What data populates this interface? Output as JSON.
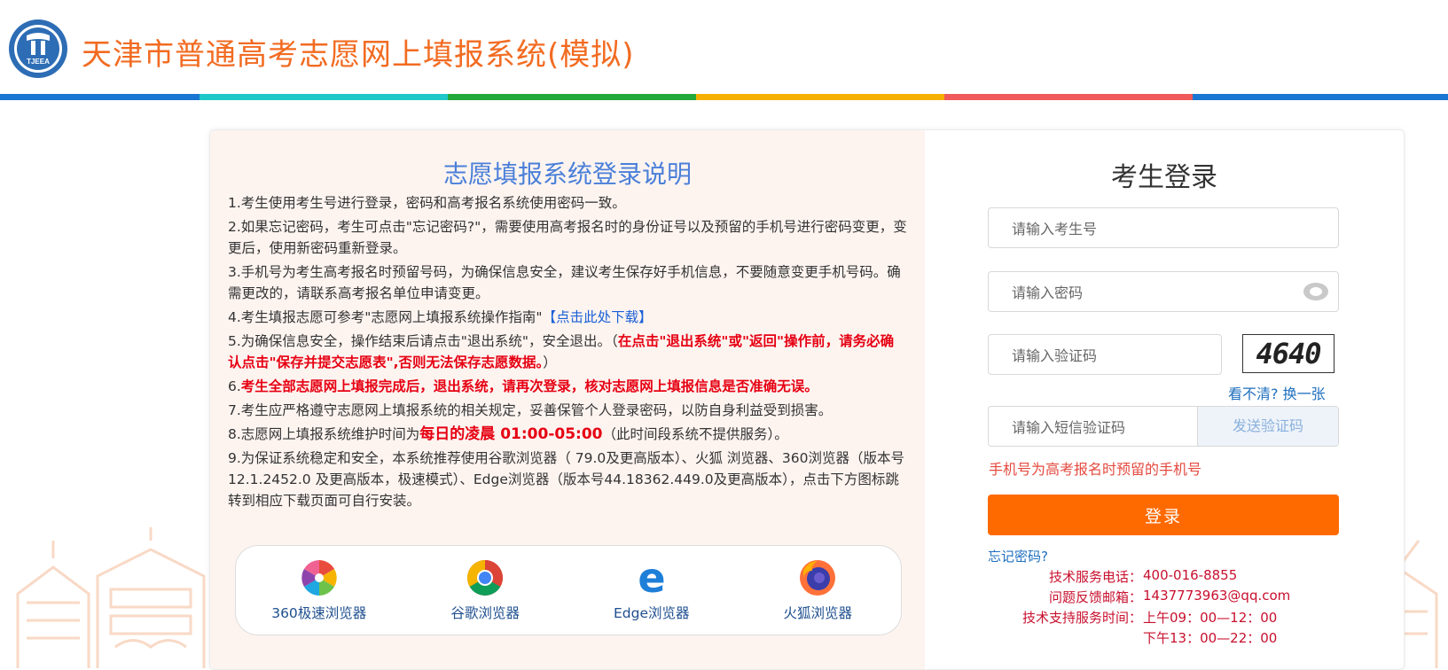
{
  "header": {
    "title": "天津市普通高考志愿网上填报系统(模拟)",
    "logo_text": "TJEEA",
    "strip_colors": [
      "#1976d2",
      "#1fc8c8",
      "#22a93a",
      "#f5b000",
      "#f05a5a",
      "#1976d2"
    ]
  },
  "instructions": {
    "title": "志愿填报系统登录说明",
    "item1": "1.考生使用考生号进行登录，密码和高考报名系统使用密码一致。",
    "item2": "2.如果忘记密码，考生可点击\"忘记密码?\"，需要使用高考报名时的身份证号以及预留的手机号进行密码变更，变更后，使用新密码重新登录。",
    "item3": "3.手机号为考生高考报名时预留号码，为确保信息安全，建议考生保存好手机信息，不要随意变更手机号码。确需更改的，请联系高考报名单位申请变更。",
    "item4_text": "4.考生填报志愿可参考\"志愿网上填报系统操作指南\"",
    "item4_link": "【点击此处下载】",
    "item5_text": "5.为确保信息安全，操作结束后请点击\"退出系统\"，安全退出。（",
    "item5_red": "在点击\"退出系统\"或\"返回\"操作前，请务必确认点击\"保存并提交志愿表\",否则无法保存志愿数据。",
    "item5_end": "）",
    "item6_prefix": "6.",
    "item6_red": "考生全部志愿网上填报完成后，退出系统，请再次登录，核对志愿网上填报信息是否准确无误。",
    "item7": "7.考生应严格遵守志愿网上填报系统的相关规定，妥善保管个人登录密码，以防自身利益受到损害。",
    "item8_text": "8.志愿网上填报系统维护时间为",
    "item8_red": "每日的凌晨 01:00-05:00",
    "item8_end": "（此时间段系统不提供服务）。",
    "item9": "9.为保证系统稳定和安全，本系统推荐使用谷歌浏览器（ 79.0及更高版本）、火狐 浏览器、360浏览器（版本号12.1.2452.0 及更高版本，极速模式）、Edge浏览器（版本号44.18362.449.0及更高版本），点击下方图标跳转到相应下载页面可自行安装。"
  },
  "browsers": [
    {
      "label": "360极速浏览器",
      "icon": "browser-360-icon"
    },
    {
      "label": "谷歌浏览器",
      "icon": "chrome-icon"
    },
    {
      "label": "Edge浏览器",
      "icon": "edge-icon"
    },
    {
      "label": "火狐浏览器",
      "icon": "firefox-icon"
    }
  ],
  "login": {
    "title": "考生登录",
    "exam_no_placeholder": "请输入考生号",
    "password_placeholder": "请输入密码",
    "captcha_placeholder": "请输入验证码",
    "captcha_text": "4640",
    "refresh_text": "看不清? 换一张",
    "sms_placeholder": "请输入短信验证码",
    "send_code": "发送验证码",
    "phone_hint": "手机号为高考报名时预留的手机号",
    "login_button": "登录",
    "forgot_password": "忘记密码?",
    "support": {
      "phone_label": "技术服务电话：",
      "phone_value": "400-016-8855",
      "email_label": "问题反馈邮箱：",
      "email_value": "1437773963@qq.com",
      "hours_label": "技术支持服务时间：",
      "hours_am": "上午09：00—12：00",
      "hours_pm": "下午13：00—22：00"
    }
  },
  "colors": {
    "brand_orange": "#f26b21",
    "login_button": "#ff6a00",
    "link_blue": "#1e6fbf",
    "alert_red": "#e60012"
  }
}
